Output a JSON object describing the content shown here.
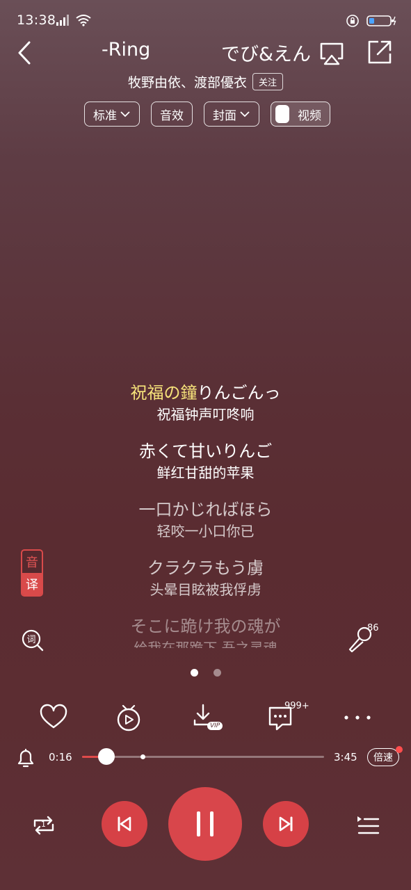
{
  "status": {
    "time": "13:38"
  },
  "header": {
    "title_part1": "-Ring",
    "title_part2": "でび&えん",
    "artists": "牧野由依、渡部優衣",
    "follow_label": "关注"
  },
  "chips": {
    "quality": "标准",
    "effect": "音效",
    "cover": "封面",
    "video": "视频"
  },
  "lyrics": [
    {
      "line_hl": "祝福の鐘",
      "line_rest": "りんごんっ",
      "trans": "祝福钟声叮咚响"
    },
    {
      "line_hl": "",
      "line_rest": "赤くて甘いりんご",
      "trans": "鲜红甘甜的苹果"
    },
    {
      "line_hl": "",
      "line_rest": "一口かじればほら",
      "trans": "轻咬一小口你已"
    },
    {
      "line_hl": "",
      "line_rest": "クラクラもう虜",
      "trans": "头晕目眩被我俘虏"
    },
    {
      "line_hl": "",
      "line_rest": "そこに跪け我の魂が",
      "trans": "给我在那跪下 吾之灵魂"
    }
  ],
  "translate_badge": {
    "top": "音",
    "bottom": "译"
  },
  "mic_count": "86",
  "pager": {
    "pages": 2,
    "active": 0
  },
  "comments_count": "999+",
  "download_badge": "VIP",
  "playback": {
    "current": "0:16",
    "total": "3:45",
    "progress": 0.1,
    "buffered": 0.25,
    "speed_label": "倍速"
  },
  "repeat_badge": "1",
  "colors": {
    "accent": "#d8464b",
    "lyric_highlight": "#f6e27a"
  }
}
